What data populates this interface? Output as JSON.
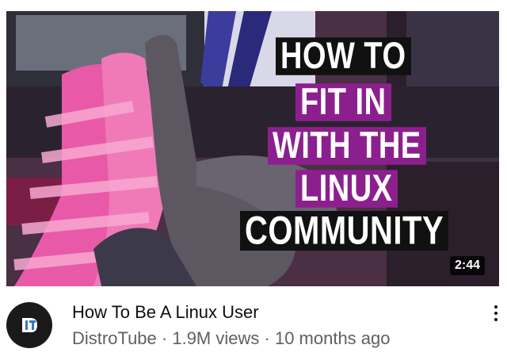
{
  "video": {
    "thumbnail": {
      "title_lines": [
        {
          "text": "HOW TO",
          "style": "black"
        },
        {
          "text": "FIT IN",
          "style": "purple"
        },
        {
          "text": "WITH THE",
          "style": "purple"
        },
        {
          "text": "LINUX",
          "style": "purple"
        },
        {
          "text": "COMMUNITY",
          "style": "black"
        }
      ],
      "duration": "2:44",
      "colors": {
        "accent_purple": "#8c1f8e",
        "black": "#111111"
      }
    },
    "title": "How To Be A Linux User",
    "channel": "DistroTube",
    "views": "1.9M views",
    "age": "10 months ago",
    "separator": " · "
  },
  "icons": {
    "avatar": "distrotube-logo-icon",
    "more": "more-vert-icon"
  }
}
